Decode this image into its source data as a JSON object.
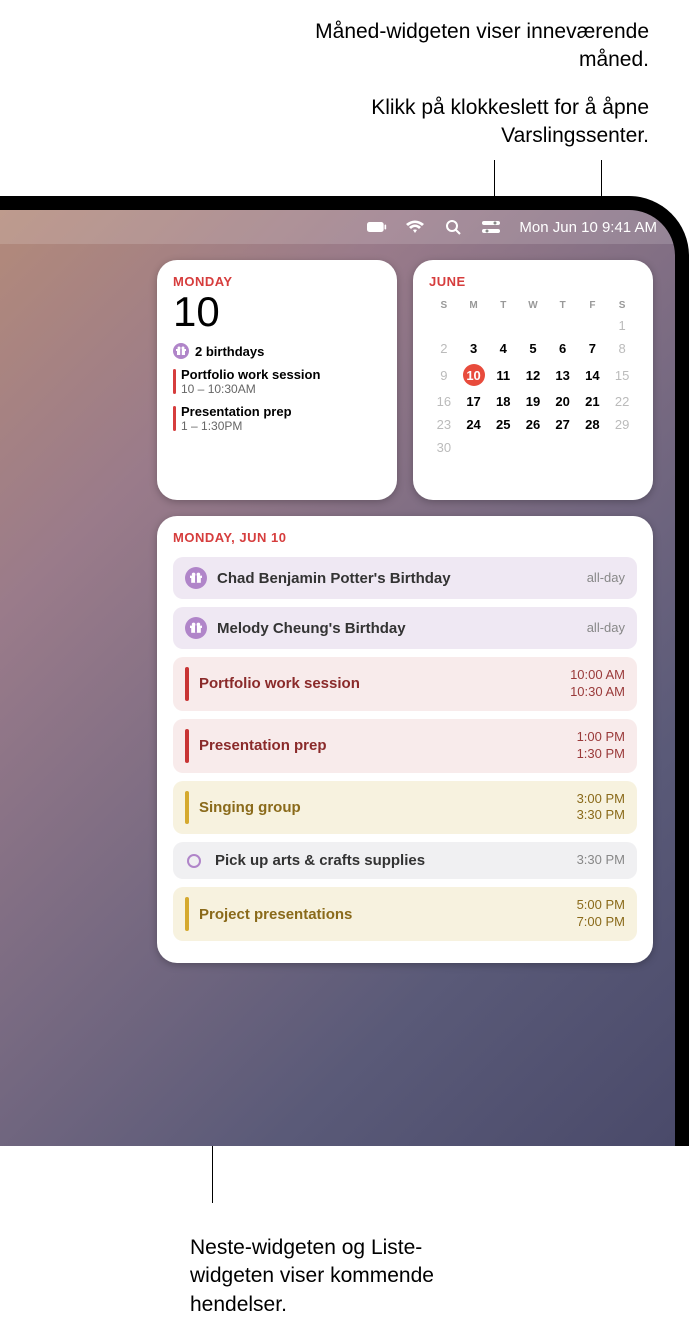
{
  "annotations": {
    "a1": "Måned-widgeten viser inneværende måned.",
    "a2": "Klikk på klokkeslett for å åpne Varslingssenter.",
    "a3": "Neste-widgeten og Liste-widgeten viser kommende hendelser."
  },
  "menubar": {
    "datetime": "Mon Jun 10  9:41 AM"
  },
  "today_widget": {
    "day_label": "MONDAY",
    "date_number": "10",
    "birthdays_text": "2 birthdays",
    "events": [
      {
        "title": "Portfolio work session",
        "time": "10 – 10:30AM"
      },
      {
        "title": "Presentation prep",
        "time": "1 – 1:30PM"
      }
    ]
  },
  "month_widget": {
    "month_label": "JUNE",
    "dow": [
      "S",
      "M",
      "T",
      "W",
      "T",
      "F",
      "S"
    ],
    "grid": [
      [
        "",
        "",
        "",
        "",
        "",
        "",
        "1"
      ],
      [
        "2",
        "3",
        "4",
        "5",
        "6",
        "7",
        "8"
      ],
      [
        "9",
        "10",
        "11",
        "12",
        "13",
        "14",
        "15"
      ],
      [
        "16",
        "17",
        "18",
        "19",
        "20",
        "21",
        "22"
      ],
      [
        "23",
        "24",
        "25",
        "26",
        "27",
        "28",
        "29"
      ],
      [
        "30",
        "",
        "",
        "",
        "",
        "",
        ""
      ]
    ],
    "today": "10",
    "dim_cells": [
      "1",
      "8",
      "15",
      "22",
      "29"
    ]
  },
  "list_widget": {
    "header": "MONDAY, JUN 10",
    "events": [
      {
        "kind": "birthday",
        "name": "Chad Benjamin Potter's Birthday",
        "time1": "all-day",
        "time2": ""
      },
      {
        "kind": "birthday",
        "name": "Melody Cheung's Birthday",
        "time1": "all-day",
        "time2": ""
      },
      {
        "kind": "red",
        "name": "Portfolio work session",
        "time1": "10:00 AM",
        "time2": "10:30 AM"
      },
      {
        "kind": "red",
        "name": "Presentation prep",
        "time1": "1:00 PM",
        "time2": "1:30 PM"
      },
      {
        "kind": "yellow",
        "name": "Singing group",
        "time1": "3:00 PM",
        "time2": "3:30 PM"
      },
      {
        "kind": "open",
        "name": "Pick up arts & crafts supplies",
        "time1": "3:30 PM",
        "time2": ""
      },
      {
        "kind": "yellow",
        "name": "Project presentations",
        "time1": "5:00 PM",
        "time2": "7:00 PM"
      }
    ]
  }
}
